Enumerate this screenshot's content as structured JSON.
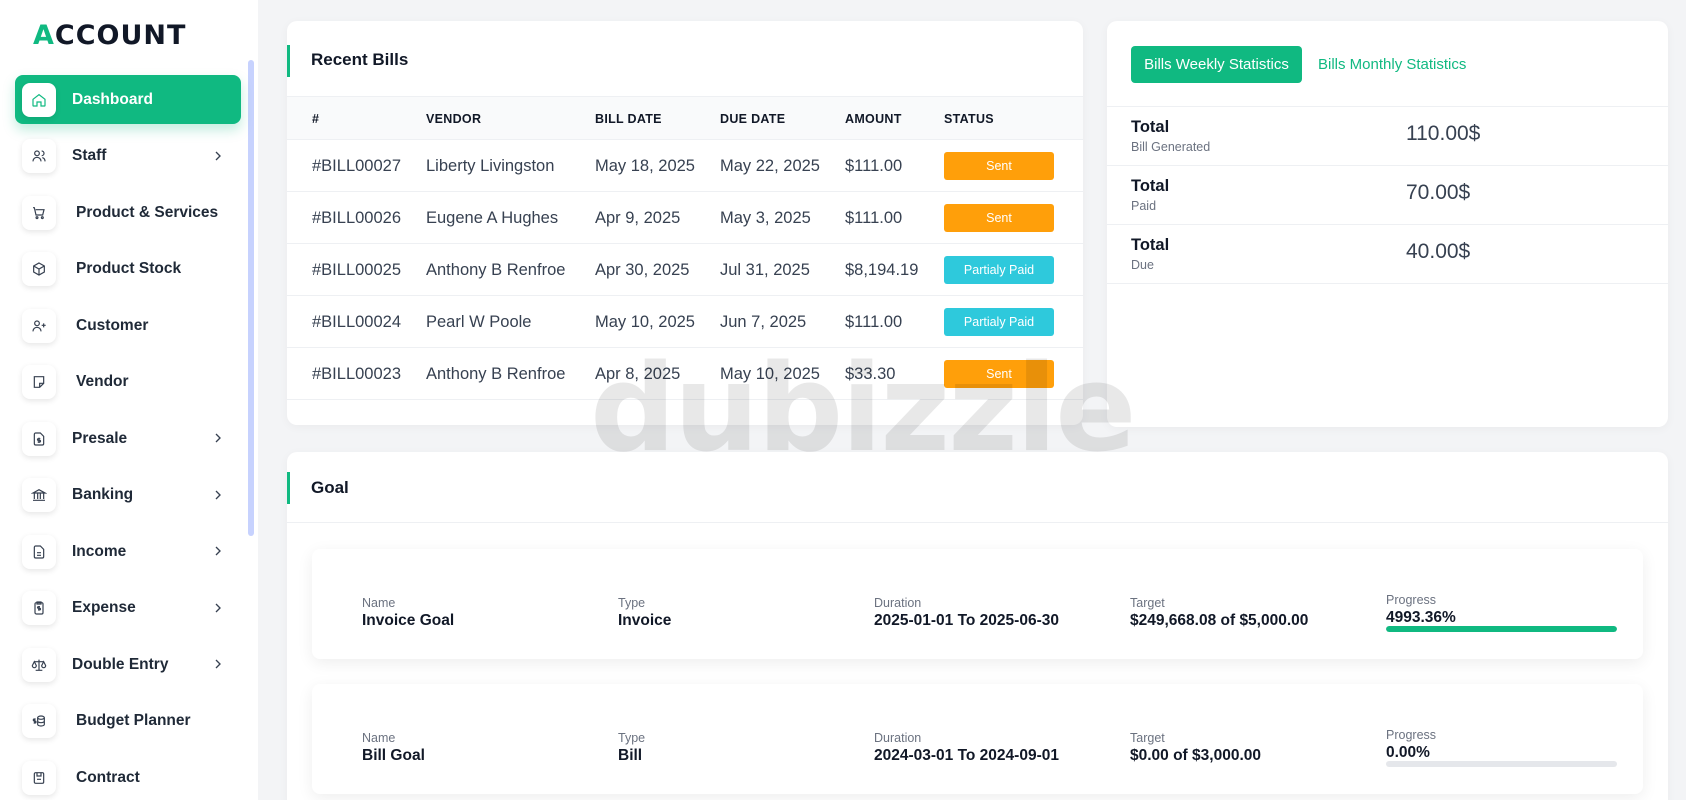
{
  "sidebar": {
    "logo": "ACCOUNT",
    "items": [
      {
        "label": "Dashboard",
        "icon": "home-icon"
      },
      {
        "label": "Staff",
        "icon": "users-icon"
      },
      {
        "label": "Product & Services",
        "icon": "cart-icon"
      },
      {
        "label": "Product Stock",
        "icon": "box-icon"
      },
      {
        "label": "Customer",
        "icon": "user-plus-icon"
      },
      {
        "label": "Vendor",
        "icon": "note-icon"
      },
      {
        "label": "Presale",
        "icon": "file-dollar-icon"
      },
      {
        "label": "Banking",
        "icon": "bank-icon"
      },
      {
        "label": "Income",
        "icon": "file-icon"
      },
      {
        "label": "Expense",
        "icon": "receipt-icon"
      },
      {
        "label": "Double Entry",
        "icon": "scale-icon"
      },
      {
        "label": "Budget Planner",
        "icon": "coins-icon"
      },
      {
        "label": "Contract",
        "icon": "contract-icon"
      }
    ]
  },
  "recent_bills": {
    "title": "Recent Bills",
    "columns": [
      "#",
      "VENDOR",
      "BILL DATE",
      "DUE DATE",
      "AMOUNT",
      "STATUS"
    ],
    "rows": [
      {
        "id": "#BILL00027",
        "vendor": "Liberty Livingston",
        "bill_date": "May 18, 2025",
        "due_date": "May 22, 2025",
        "amount": "$111.00",
        "status": "Sent"
      },
      {
        "id": "#BILL00026",
        "vendor": "Eugene A Hughes",
        "bill_date": "Apr 9, 2025",
        "due_date": "May 3, 2025",
        "amount": "$111.00",
        "status": "Sent"
      },
      {
        "id": "#BILL00025",
        "vendor": "Anthony B Renfroe",
        "bill_date": "Apr 30, 2025",
        "due_date": "Jul 31, 2025",
        "amount": "$8,194.19",
        "status": "Partialy Paid"
      },
      {
        "id": "#BILL00024",
        "vendor": "Pearl W Poole",
        "bill_date": "May 10, 2025",
        "due_date": "Jun 7, 2025",
        "amount": "$111.00",
        "status": "Partialy Paid"
      },
      {
        "id": "#BILL00023",
        "vendor": "Anthony B Renfroe",
        "bill_date": "Apr 8, 2025",
        "due_date": "May 10, 2025",
        "amount": "$33.30",
        "status": "Sent"
      }
    ]
  },
  "stats": {
    "tabs": [
      "Bills Weekly Statistics",
      "Bills Monthly Statistics"
    ],
    "rows": [
      {
        "label": "Total",
        "sub": "Bill Generated",
        "value": "110.00$"
      },
      {
        "label": "Total",
        "sub": "Paid",
        "value": "70.00$"
      },
      {
        "label": "Total",
        "sub": "Due",
        "value": "40.00$"
      }
    ]
  },
  "goal": {
    "title": "Goal",
    "field_labels": {
      "name": "Name",
      "type": "Type",
      "duration": "Duration",
      "target": "Target",
      "progress": "Progress"
    },
    "items": [
      {
        "name": "Invoice Goal",
        "type": "Invoice",
        "duration": "2025-01-01 To 2025-06-30",
        "target": "$249,668.08 of $5,000.00",
        "progress": "4993.36%",
        "progress_fill": 1.0
      },
      {
        "name": "Bill Goal",
        "type": "Bill",
        "duration": "2024-03-01 To 2024-09-01",
        "target": "$0.00 of $3,000.00",
        "progress": "0.00%",
        "progress_fill": 0.0
      }
    ]
  },
  "watermark": "dubizzle",
  "colors": {
    "accent": "#10b981",
    "sent": "#ff9f0a",
    "partial": "#2ec9dc"
  }
}
